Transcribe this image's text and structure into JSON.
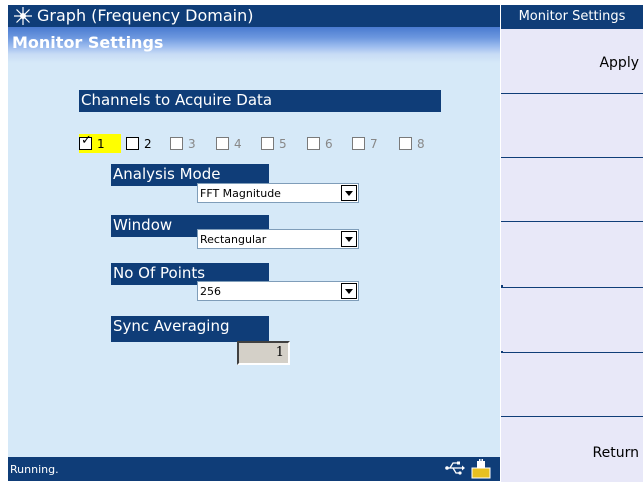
{
  "app": {
    "title": "Graph (Frequency Domain)",
    "page_title": "Monitor Settings"
  },
  "channels": {
    "label": "Channels to Acquire Data",
    "items": [
      {
        "num": "1",
        "checked": true,
        "enabled": true
      },
      {
        "num": "2",
        "checked": false,
        "enabled": true
      },
      {
        "num": "3",
        "checked": false,
        "enabled": false
      },
      {
        "num": "4",
        "checked": false,
        "enabled": false
      },
      {
        "num": "5",
        "checked": false,
        "enabled": false
      },
      {
        "num": "6",
        "checked": false,
        "enabled": false
      },
      {
        "num": "7",
        "checked": false,
        "enabled": false
      },
      {
        "num": "8",
        "checked": false,
        "enabled": false
      }
    ]
  },
  "analysis_mode": {
    "label": "Analysis Mode",
    "value": "FFT Magnitude"
  },
  "window": {
    "label": "Window",
    "value": "Rectangular"
  },
  "points": {
    "label": "No Of Points",
    "value": "256"
  },
  "sync_averaging": {
    "label": "Sync Averaging",
    "value": "1"
  },
  "status": {
    "text": "Running."
  },
  "softkeys": {
    "title": "Monitor Settings",
    "keys": [
      "Apply",
      "",
      "",
      "",
      "",
      "",
      "Return"
    ]
  },
  "colors": {
    "titlebar": "#0f3d78",
    "pane_bg": "#d6e9f8",
    "softkey_bg": "#e8e8f8",
    "highlight": "#ffff00"
  },
  "icons": [
    "app-logo-icon",
    "usb-icon",
    "power-icon"
  ]
}
